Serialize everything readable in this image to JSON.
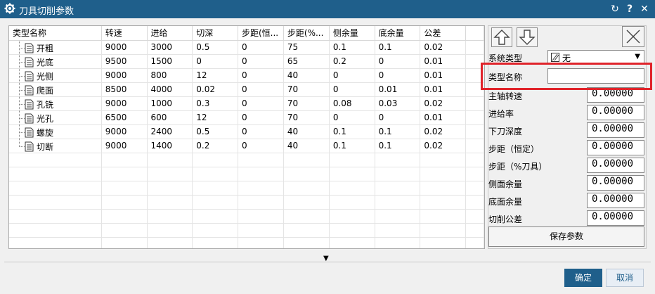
{
  "window": {
    "title": "刀具切削参数",
    "icons": [
      "gear-icon",
      "reset-icon",
      "help-icon",
      "close-icon"
    ],
    "help_label": "?",
    "close_label": "✕",
    "reset_label": "↻"
  },
  "table": {
    "columns": [
      "类型名称",
      "转速",
      "进给",
      "切深",
      "步距(恒...",
      "步距(%...",
      "侧余量",
      "底余量",
      "公差"
    ],
    "rows": [
      [
        "开粗",
        "9000",
        "3000",
        "0.5",
        "0",
        "75",
        "0.1",
        "0.1",
        "0.02"
      ],
      [
        "光底",
        "9500",
        "1500",
        "0",
        "0",
        "65",
        "0.2",
        "0",
        "0.01"
      ],
      [
        "光侧",
        "9000",
        "800",
        "12",
        "0",
        "40",
        "0",
        "0",
        "0.01"
      ],
      [
        "爬面",
        "8500",
        "4000",
        "0.02",
        "0",
        "70",
        "0",
        "0.01",
        "0.01"
      ],
      [
        "孔铣",
        "9000",
        "1000",
        "0.3",
        "0",
        "70",
        "0.08",
        "0.03",
        "0.02"
      ],
      [
        "光孔",
        "6500",
        "600",
        "12",
        "0",
        "70",
        "0",
        "0",
        "0.01"
      ],
      [
        "螺旋",
        "9000",
        "2400",
        "0.5",
        "0",
        "40",
        "0.1",
        "0.1",
        "0.02"
      ],
      [
        "切断",
        "9000",
        "1400",
        "0.2",
        "0",
        "40",
        "0.1",
        "0.1",
        "0.02"
      ]
    ]
  },
  "right_panel": {
    "up_icon": "arrow-up-icon",
    "down_icon": "arrow-down-icon",
    "delete_icon": "close-x-icon",
    "system_type_label": "系统类型",
    "system_type_value": "无",
    "type_name_label": "类型名称",
    "type_name_value": "",
    "params": [
      {
        "label": "主轴转速",
        "value": "0.00000"
      },
      {
        "label": "进给率",
        "value": "0.00000"
      },
      {
        "label": "下刀深度",
        "value": "0.00000"
      },
      {
        "label": "步距（恒定）",
        "value": "0.00000"
      },
      {
        "label": "步距（%刀具）",
        "value": "0.00000"
      },
      {
        "label": "侧面余量",
        "value": "0.00000"
      },
      {
        "label": "底面余量",
        "value": "0.00000"
      },
      {
        "label": "切削公差",
        "value": "0.00000"
      }
    ],
    "save_label": "保存参数"
  },
  "footer": {
    "expand_label": "▼",
    "ok_label": "确定",
    "cancel_label": "取消"
  },
  "colors": {
    "titlebar": "#1f5f8b",
    "highlight": "#e0242b",
    "ok_button": "#1f5f8b"
  }
}
